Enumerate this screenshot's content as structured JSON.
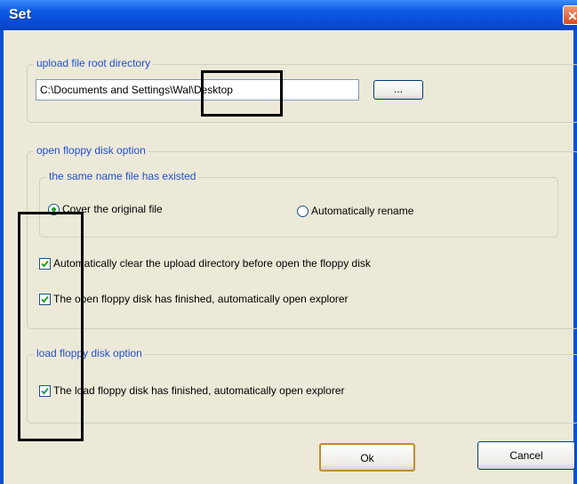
{
  "window": {
    "title": "Set",
    "close_glyph": "✕"
  },
  "upload": {
    "legend": "upload file root directory",
    "path": "C:\\Documents and Settings\\Wal\\Desktop",
    "browse_label": "..."
  },
  "floppy_open": {
    "legend": "open floppy disk option",
    "same_name_legend": "the same name file has existed",
    "radio_cover": "Cover the original file",
    "radio_rename": "Automatically rename",
    "check_clear": "Automatically clear the upload directory before open the floppy disk",
    "check_explorer": "The open floppy disk has finished, automatically open explorer"
  },
  "floppy_load": {
    "legend": "load floppy disk option",
    "check_explorer": "The load floppy disk has finished, automatically open explorer"
  },
  "buttons": {
    "ok": "Ok",
    "cancel": "Cancel"
  },
  "state": {
    "cover_selected": true,
    "clear_checked": true,
    "open_explorer_checked": true,
    "load_explorer_checked": true
  }
}
